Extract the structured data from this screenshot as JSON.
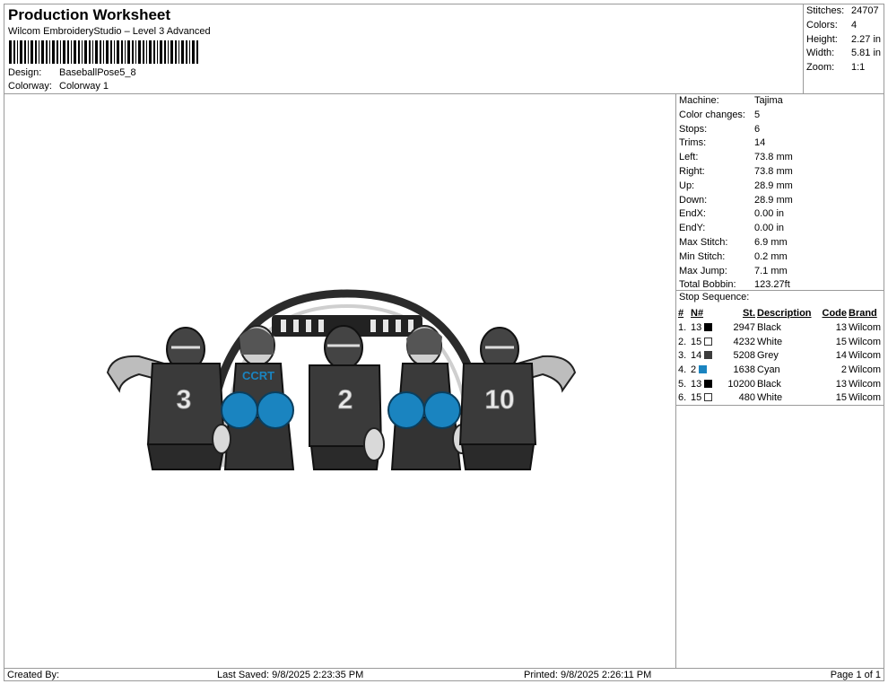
{
  "header": {
    "title": "Production Worksheet",
    "subtitle": "Wilcom EmbroideryStudio – Level 3 Advanced",
    "design_label": "Design:",
    "design_value": "BaseballPose5_8",
    "colorway_label": "Colorway:",
    "colorway_value": "Colorway 1"
  },
  "summary": [
    {
      "label": "Stitches:",
      "value": "24707"
    },
    {
      "label": "Colors:",
      "value": "4"
    },
    {
      "label": "Height:",
      "value": "2.27 in"
    },
    {
      "label": "Width:",
      "value": "5.81 in"
    },
    {
      "label": "Zoom:",
      "value": "1:1"
    }
  ],
  "specs": [
    {
      "label": "Machine:",
      "value": "Tajima"
    },
    {
      "label": "Color changes:",
      "value": "5"
    },
    {
      "label": "Stops:",
      "value": "6"
    },
    {
      "label": "Trims:",
      "value": "14"
    },
    {
      "label": "Left:",
      "value": "73.8 mm"
    },
    {
      "label": "Right:",
      "value": "73.8 mm"
    },
    {
      "label": "Up:",
      "value": "28.9 mm"
    },
    {
      "label": "Down:",
      "value": "28.9 mm"
    },
    {
      "label": "EndX:",
      "value": "0.00 in"
    },
    {
      "label": "EndY:",
      "value": "0.00 in"
    },
    {
      "label": "Max Stitch:",
      "value": "6.9 mm"
    },
    {
      "label": "Min Stitch:",
      "value": "0.2 mm"
    },
    {
      "label": "Max Jump:",
      "value": "7.1 mm"
    },
    {
      "label": "Total Bobbin:",
      "value": "123.27ft"
    }
  ],
  "stop_sequence": {
    "title": "Stop Sequence:",
    "headers": {
      "num": "#",
      "needle": "N#",
      "stitches": "St.",
      "description": "Description",
      "code": "Code",
      "brand": "Brand"
    },
    "rows": [
      {
        "num": "1.",
        "needle": "13",
        "color": "#000000",
        "stitches": "2947",
        "description": "Black",
        "code": "13",
        "brand": "Wilcom"
      },
      {
        "num": "2.",
        "needle": "15",
        "color": "#ffffff",
        "stitches": "4232",
        "description": "White",
        "code": "15",
        "brand": "Wilcom"
      },
      {
        "num": "3.",
        "needle": "14",
        "color": "#3c3c3c",
        "stitches": "5208",
        "description": "Grey",
        "code": "14",
        "brand": "Wilcom"
      },
      {
        "num": "4.",
        "needle": "2",
        "color": "#1a84c0",
        "stitches": "1638",
        "description": "Cyan",
        "code": "2",
        "brand": "Wilcom"
      },
      {
        "num": "5.",
        "needle": "13",
        "color": "#000000",
        "stitches": "10200",
        "description": "Black",
        "code": "13",
        "brand": "Wilcom"
      },
      {
        "num": "6.",
        "needle": "15",
        "color": "#ffffff",
        "stitches": "480",
        "description": "White",
        "code": "15",
        "brand": "Wilcom"
      }
    ]
  },
  "design_preview": {
    "jersey_numbers": [
      "3",
      "2",
      "10"
    ],
    "shirt_text": "CCRT"
  },
  "footer": {
    "created_by": "Created By:",
    "last_saved": "Last Saved: 9/8/2025 2:23:35 PM",
    "printed": "Printed: 9/8/2025 2:26:11 PM",
    "page": "Page 1 of 1"
  },
  "colors": {
    "border": "#9a9a9a",
    "cyan": "#1a84c0",
    "jersey": "#3a3a3a"
  }
}
